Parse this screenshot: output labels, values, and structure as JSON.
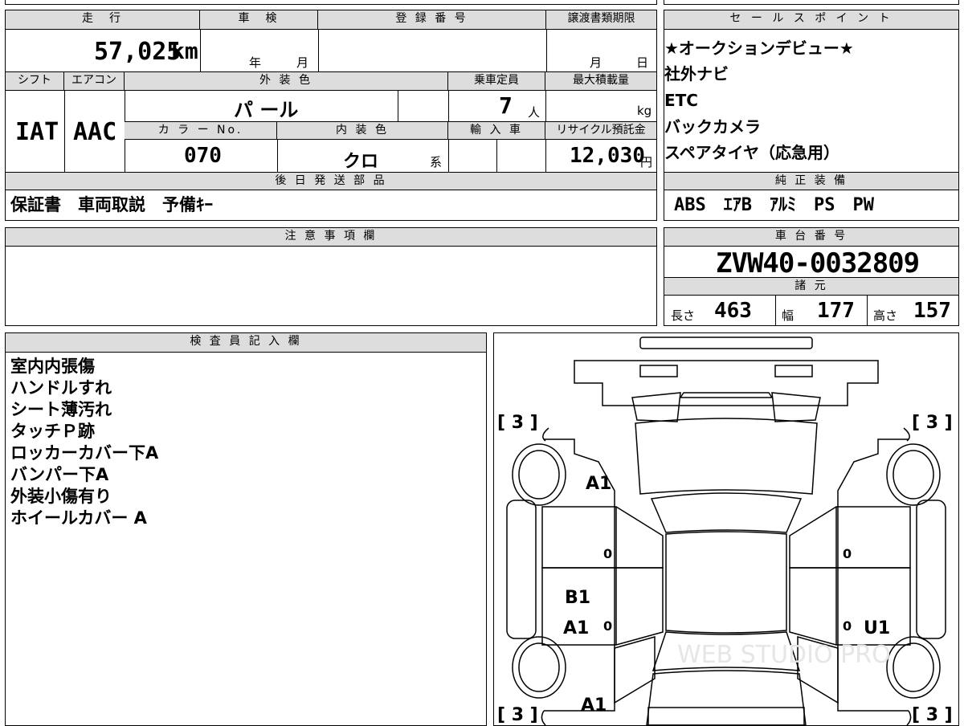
{
  "top": {
    "mileage_label": "走　行",
    "mileage_value": "57,025",
    "mileage_unit": "km",
    "inspection_label": "車　検",
    "inspection_year": "年",
    "inspection_month": "月",
    "registration_label": "登 録 番 号",
    "registration_value": "",
    "transfer_label": "譲渡書類期限",
    "transfer_month": "月",
    "transfer_day": "日",
    "shift_label": "シフト",
    "shift_value": "IAT",
    "aircon_label": "エアコン",
    "aircon_value": "AAC",
    "exterior_label": "外 装 色",
    "exterior_value": "パ ール",
    "capacity_label": "乗車定員",
    "capacity_value": "7",
    "capacity_unit": "人",
    "load_label": "最大積載量",
    "load_unit": "kg",
    "color_no_label": "カ ラ ー No.",
    "color_no_value": "070",
    "interior_label": "内 装 色",
    "interior_value": "クロ",
    "interior_suffix": "系",
    "import_label": "輸 入 車",
    "recycle_label": "リサイクル預託金",
    "recycle_value": "12,030",
    "recycle_unit": "円",
    "later_parts_label": "後 日 発 送 部 品",
    "later_parts_value": "保証書　車両取説　予備ｷｰ"
  },
  "sales": {
    "label": "セ ー ル ス ポ イ ン ト",
    "points": [
      "★オークションデビュー★",
      "社外ナビ",
      "ETC",
      "バックカメラ",
      "スペアタイヤ（応急用）"
    ],
    "equipment_label": "純 正 装 備",
    "equipment_value": "ABS　ｴｱB　ｱﾙﾐ　PS　PW"
  },
  "notes": {
    "label": "注 意 事 項 欄",
    "value": ""
  },
  "chassis": {
    "label": "車 台 番 号",
    "value": "ZVW40-0032809",
    "spec_label": "諸 元",
    "length_label": "長さ",
    "length_value": "463",
    "width_label": "幅",
    "width_value": "177",
    "height_label": "高さ",
    "height_value": "157"
  },
  "inspector": {
    "label": "検 査 員 記 入 欄",
    "lines": [
      "室内内張傷",
      "ハンドルすれ",
      "シート薄汚れ",
      "タッチＰ跡",
      "ロッカーカバー下A",
      "バンパー下A",
      "外装小傷有り",
      "ホイールカバー A"
    ]
  },
  "diagram": {
    "tire_tl": "[ 3 ]",
    "tire_tr": "[ 3 ]",
    "tire_bl": "[ 3 ]",
    "tire_br": "[ 3 ]",
    "mark_a1_front": "A1",
    "mark_b1": "B1",
    "mark_a1_door": "A1",
    "mark_u1": "U1",
    "mark_a1_rear": "A1",
    "zero_1": "0",
    "zero_2": "0",
    "zero_3": "0",
    "zero_4": "0",
    "watermark": "WEB STUDIO PRO"
  }
}
